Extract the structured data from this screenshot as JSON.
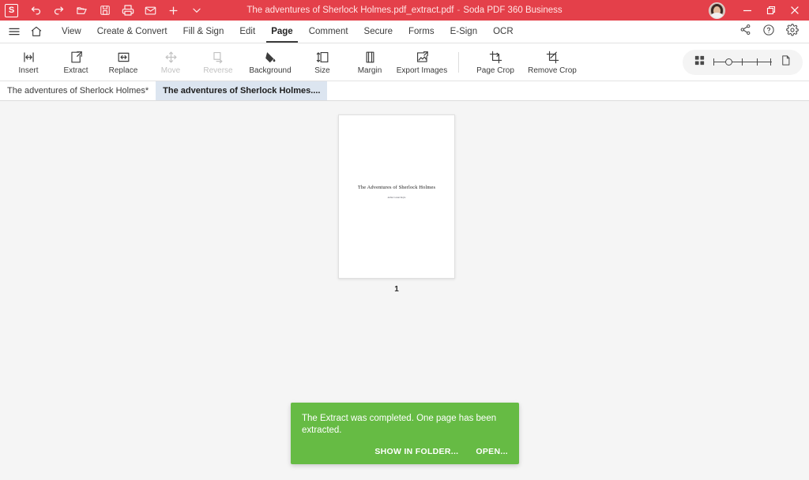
{
  "titlebar": {
    "logo_letter": "S",
    "document_name": "The adventures of Sherlock Holmes.pdf_extract.pdf",
    "separator": "-",
    "app_name": "Soda PDF 360 Business",
    "quick_icons": [
      {
        "name": "undo-icon",
        "label": "Undo"
      },
      {
        "name": "redo-icon",
        "label": "Redo"
      },
      {
        "name": "open-folder-icon",
        "label": "Open"
      },
      {
        "name": "save-icon",
        "label": "Save"
      },
      {
        "name": "print-icon",
        "label": "Print"
      },
      {
        "name": "email-icon",
        "label": "Email"
      },
      {
        "name": "add-icon",
        "label": "New"
      },
      {
        "name": "chevron-down-icon",
        "label": "More"
      }
    ],
    "window_controls": [
      {
        "name": "minimize-button",
        "label": "Minimize"
      },
      {
        "name": "maximize-button",
        "label": "Restore"
      },
      {
        "name": "close-button",
        "label": "Close"
      }
    ]
  },
  "menubar": {
    "hamburger_icon": "hamburger-menu-icon",
    "home_icon": "home-icon",
    "items": [
      {
        "label": "View",
        "active": false
      },
      {
        "label": "Create & Convert",
        "active": false
      },
      {
        "label": "Fill & Sign",
        "active": false
      },
      {
        "label": "Edit",
        "active": false
      },
      {
        "label": "Page",
        "active": true
      },
      {
        "label": "Comment",
        "active": false
      },
      {
        "label": "Secure",
        "active": false
      },
      {
        "label": "Forms",
        "active": false
      },
      {
        "label": "E-Sign",
        "active": false
      },
      {
        "label": "OCR",
        "active": false
      }
    ],
    "right_icons": [
      {
        "name": "share-icon",
        "label": "Share"
      },
      {
        "name": "help-icon",
        "label": "Help"
      },
      {
        "name": "gear-icon",
        "label": "Settings"
      }
    ]
  },
  "toolbar": {
    "tools": [
      {
        "label": "Insert",
        "icon": "insert-page-icon",
        "disabled": false
      },
      {
        "label": "Extract",
        "icon": "extract-page-icon",
        "disabled": false
      },
      {
        "label": "Replace",
        "icon": "replace-page-icon",
        "disabled": false
      },
      {
        "label": "Move",
        "icon": "move-page-icon",
        "disabled": true
      },
      {
        "label": "Reverse",
        "icon": "reverse-page-icon",
        "disabled": true
      },
      {
        "label": "Background",
        "icon": "background-icon",
        "disabled": false
      },
      {
        "label": "Size",
        "icon": "page-size-icon",
        "disabled": false
      },
      {
        "label": "Margin",
        "icon": "page-margin-icon",
        "disabled": false
      },
      {
        "label": "Export Images",
        "icon": "export-images-icon",
        "disabled": false
      }
    ],
    "tools_after_separator": [
      {
        "label": "Page Crop",
        "icon": "page-crop-icon",
        "disabled": false
      },
      {
        "label": "Remove Crop",
        "icon": "remove-crop-icon",
        "disabled": false
      }
    ],
    "view_controls": {
      "grid_icon": "grid-view-icon",
      "single_page_icon": "single-page-view-icon",
      "zoom_slider_name": "zoom-slider"
    }
  },
  "doctabs": [
    {
      "label": "The adventures of Sherlock Holmes*",
      "active": false
    },
    {
      "label": "The adventures of Sherlock Holmes....",
      "active": true
    }
  ],
  "document": {
    "page_title": "The Adventures of Sherlock Holmes",
    "page_author": "Arthur Conan Doyle",
    "page_number": "1"
  },
  "toast": {
    "message": "The Extract was completed. One page has been extracted.",
    "show_in_folder_label": "SHOW IN FOLDER...",
    "open_label": "OPEN...",
    "background_color": "#66bb44"
  },
  "colors": {
    "titlebar_red": "#e4404a",
    "toast_green": "#66bb44",
    "active_tab_blue": "#dce5f0",
    "workspace_grey": "#f5f5f5"
  }
}
